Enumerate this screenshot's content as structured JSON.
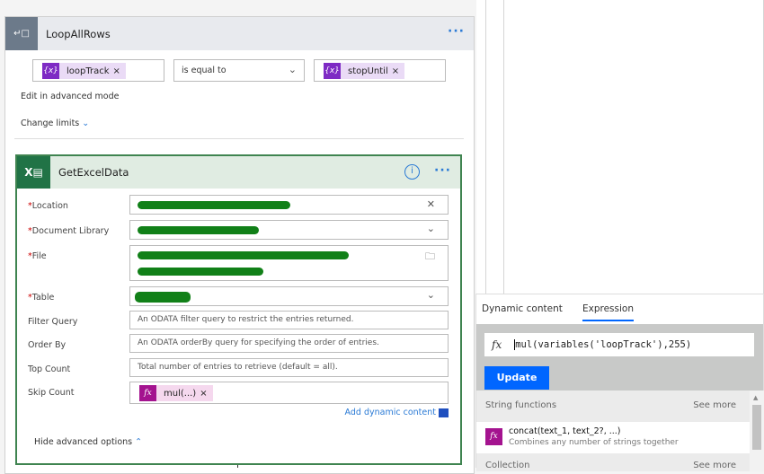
{
  "loop": {
    "title": "LoopAllRows",
    "left_token": "loopTrack",
    "operator": "is equal to",
    "right_token": "stopUntil",
    "edit_advanced": "Edit in advanced mode",
    "change_limits": "Change limits"
  },
  "excel": {
    "title": "GetExcelData",
    "fields": {
      "location": "Location",
      "doclib": "Document Library",
      "file": "File",
      "table": "Table",
      "filter": "Filter Query",
      "order": "Order By",
      "top": "Top Count",
      "skip": "Skip Count"
    },
    "placeholders": {
      "filter": "An ODATA filter query to restrict the entries returned.",
      "order": "An ODATA orderBy query for specifying the order of entries.",
      "top": "Total number of entries to retrieve (default = all)."
    },
    "skip_token": "mul(...)",
    "add_dynamic": "Add dynamic content",
    "hide_advanced": "Hide advanced options"
  },
  "panel": {
    "tabs": [
      "Dynamic content",
      "Expression"
    ],
    "active_tab": "Expression",
    "expression": "mul(variables('loopTrack'),255)",
    "update": "Update",
    "sections": [
      {
        "title": "String functions",
        "see_more": "See more"
      },
      {
        "title": "Collection",
        "see_more": "See more"
      }
    ],
    "functions": [
      {
        "name": "concat(text_1, text_2?, ...)",
        "desc": "Combines any number of strings together"
      }
    ]
  },
  "colors": {
    "accent": "#0066ff",
    "excel": "#217346",
    "variable": "#7e2bc4",
    "expression": "#a4138f"
  }
}
